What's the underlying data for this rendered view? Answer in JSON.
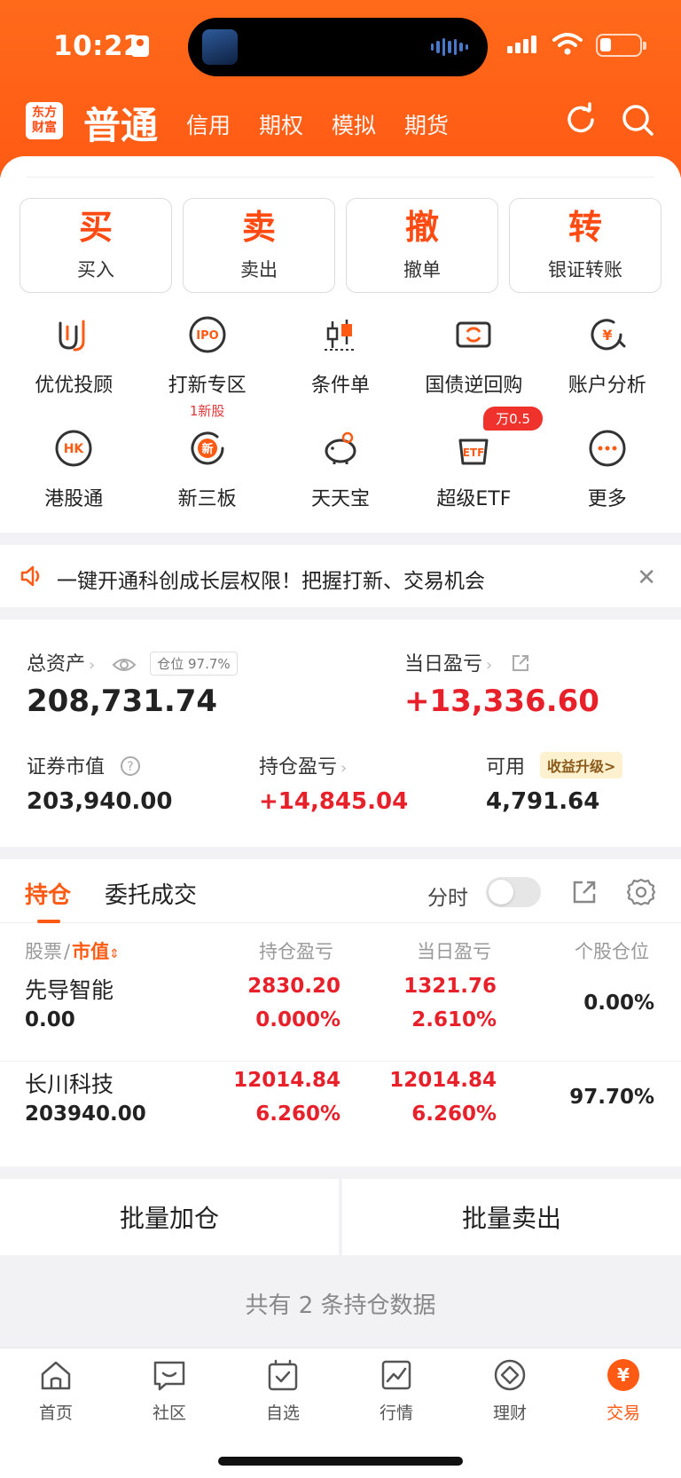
{
  "status_bar": {
    "time": "10:22"
  },
  "nav": {
    "logo_line1": "东方",
    "logo_line2": "财富",
    "current": "普通",
    "tabs": [
      "信用",
      "期权",
      "模拟",
      "期货"
    ]
  },
  "actions": [
    {
      "glyph": "买",
      "label": "买入"
    },
    {
      "glyph": "卖",
      "label": "卖出"
    },
    {
      "glyph": "撤",
      "label": "撤单"
    },
    {
      "glyph": "转",
      "label": "银证转账"
    }
  ],
  "grid": {
    "row1": [
      {
        "icon": "advisor-icon",
        "label": "优优投顾"
      },
      {
        "icon": "ipo-icon",
        "label": "打新专区",
        "sub": "1新股"
      },
      {
        "icon": "conditional-order-icon",
        "label": "条件单"
      },
      {
        "icon": "repo-icon",
        "label": "国债逆回购"
      },
      {
        "icon": "account-analysis-icon",
        "label": "账户分析"
      }
    ],
    "row2": [
      {
        "icon": "hk-connect-icon",
        "label": "港股通"
      },
      {
        "icon": "neeq-icon",
        "label": "新三板"
      },
      {
        "icon": "piggy-bank-icon",
        "label": "天天宝"
      },
      {
        "icon": "etf-icon",
        "label": "超级ETF",
        "badge": "万0.5"
      },
      {
        "icon": "more-icon",
        "label": "更多"
      }
    ]
  },
  "notice": {
    "text": "一键开通科创成长层权限！把握打新、交易机会"
  },
  "assets": {
    "total_label": "总资产",
    "position_ratio": "仓位 97.7%",
    "total_value": "208,731.74",
    "daily_pl_label": "当日盈亏",
    "daily_pl_value": "+13,336.60",
    "market_value_label": "证券市值",
    "market_value": "203,940.00",
    "holding_pl_label": "持仓盈亏",
    "holding_pl_value": "+14,845.04",
    "available_label": "可用",
    "upgrade_badge": "收益升级>",
    "available_value": "4,791.64"
  },
  "positions": {
    "tab_active": "持仓",
    "tab_other": "委托成交",
    "intraday_label": "分时",
    "columns": {
      "stock": "股票",
      "sep": "/",
      "market_value": "市值",
      "holding_pl": "持仓盈亏",
      "daily_pl": "当日盈亏",
      "weight": "个股仓位"
    },
    "rows": [
      {
        "name": "先导智能",
        "value": "0.00",
        "holding_pl": "2830.20",
        "holding_pl_pct": "0.000%",
        "daily_pl": "1321.76",
        "daily_pl_pct": "2.610%",
        "weight": "0.00%"
      },
      {
        "name": "长川科技",
        "value": "203940.00",
        "holding_pl": "12014.84",
        "holding_pl_pct": "6.260%",
        "daily_pl": "12014.84",
        "daily_pl_pct": "6.260%",
        "weight": "97.70%"
      }
    ]
  },
  "batch": {
    "add": "批量加仓",
    "sell": "批量卖出"
  },
  "footnote": "共有 2 条持仓数据",
  "bottom_nav": [
    {
      "label": "首页"
    },
    {
      "label": "社区"
    },
    {
      "label": "自选"
    },
    {
      "label": "行情"
    },
    {
      "label": "理财"
    },
    {
      "label": "交易"
    }
  ],
  "colors": {
    "brand": "#ff5a14",
    "gain": "#e8202a",
    "active_tab": "#ff5a14"
  }
}
